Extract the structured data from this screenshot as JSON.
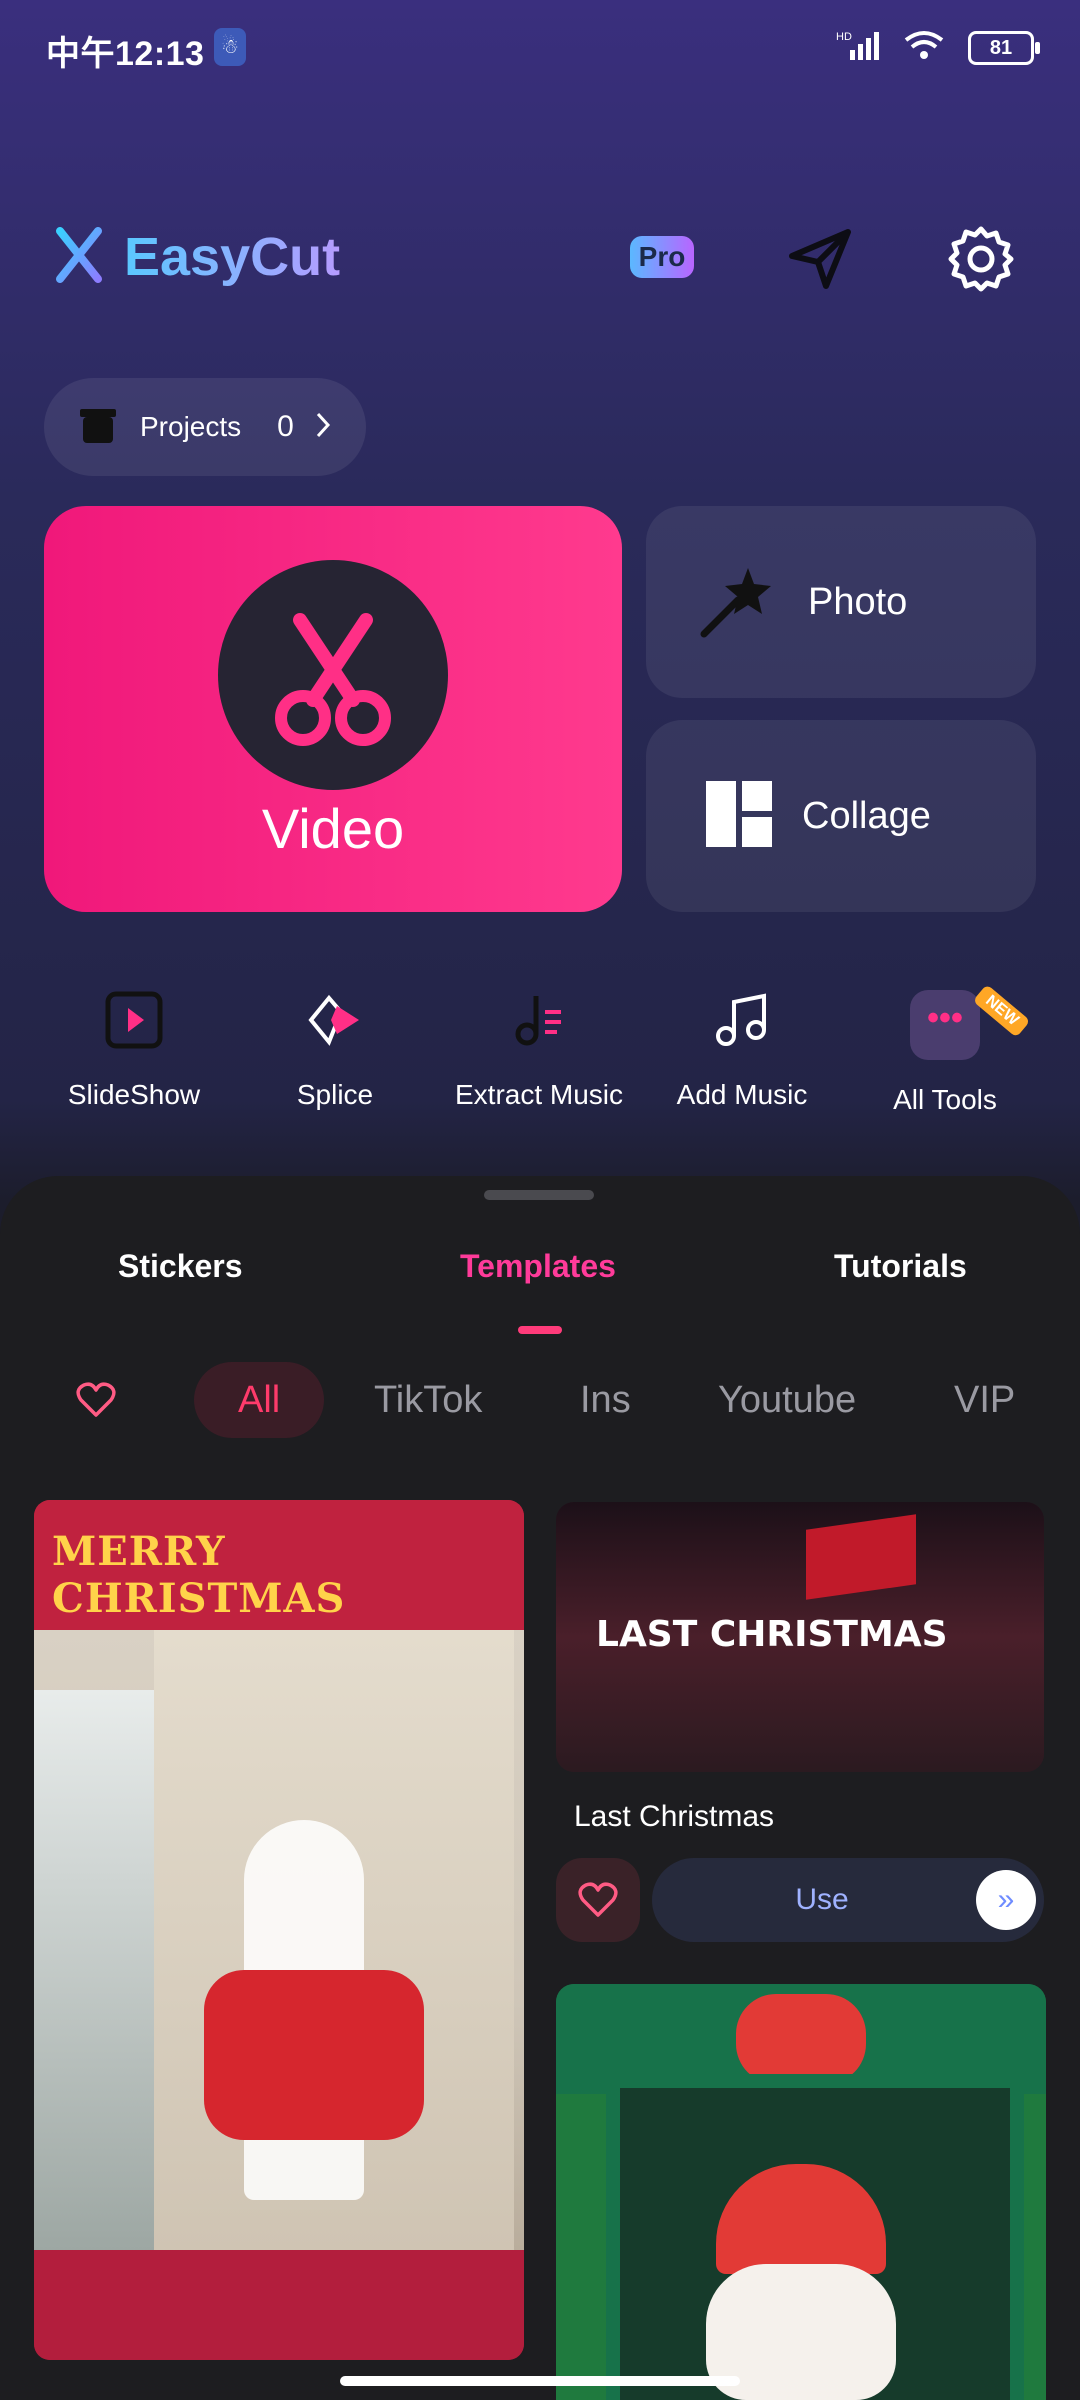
{
  "status_bar": {
    "time": "中午12:13",
    "badge": "☃",
    "network": "HD",
    "battery": "81"
  },
  "header": {
    "app_name": "EasyCut",
    "pro_label": "Pro"
  },
  "projects": {
    "label": "Projects",
    "count": "0"
  },
  "main_tiles": {
    "video": "Video",
    "photo": "Photo",
    "collage": "Collage"
  },
  "tools": [
    {
      "label": "SlideShow",
      "icon": "slideshow-icon"
    },
    {
      "label": "Splice",
      "icon": "splice-icon"
    },
    {
      "label": "Extract Music",
      "icon": "extract-music-icon"
    },
    {
      "label": "Add Music",
      "icon": "add-music-icon"
    },
    {
      "label": "All Tools",
      "icon": "all-tools-icon",
      "badge": "NEW"
    }
  ],
  "sheet_tabs": {
    "stickers": "Stickers",
    "templates": "Templates",
    "tutorials": "Tutorials",
    "active": "Templates"
  },
  "filters": {
    "items": [
      "All",
      "TikTok",
      "Ins",
      "Youtube",
      "VIP"
    ],
    "active": "All"
  },
  "templates": {
    "left_card_text": "MERRY CHRISTMAS",
    "right_card_1": {
      "image_text": "LAST CHRISTMAS",
      "title": "Last Christmas",
      "use_label": "Use",
      "arrow": "»"
    }
  },
  "colors": {
    "accent": "#ff3b7a",
    "video_tile": "#f0187a",
    "sheet": "#1d1d20"
  }
}
